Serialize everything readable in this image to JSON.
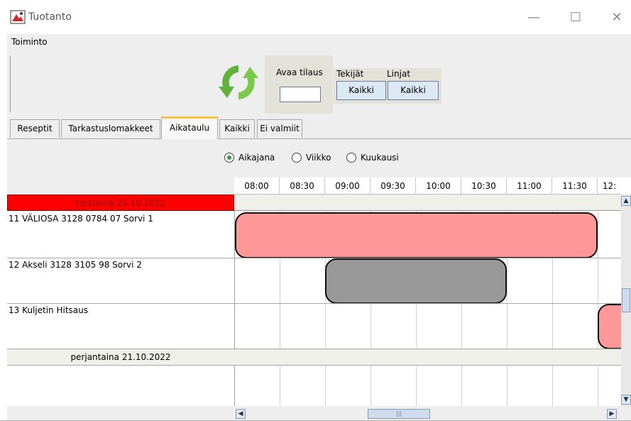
{
  "window": {
    "title": "Tuotanto",
    "minimize": "—",
    "maximize": "☐",
    "close": "✕"
  },
  "menu": {
    "items": [
      "Toiminto"
    ]
  },
  "toolbar": {
    "order_label": "Avaa tilaus",
    "order_value": "",
    "tekijat_label": "Tekijät",
    "linjat_label": "Linjat",
    "tekijat_button": "Kaikki",
    "linjat_button": "Kaikki"
  },
  "tabs": [
    {
      "label": "Reseptit",
      "active": false
    },
    {
      "label": "Tarkastuslomakkeet",
      "active": false
    },
    {
      "label": "Aikataulu",
      "active": true
    },
    {
      "label": "Kaikki",
      "active": false
    },
    {
      "label": "Ei valmiit",
      "active": false
    }
  ],
  "view_options": {
    "selected": "Aikajana",
    "options": [
      "Aikajana",
      "Viikko",
      "Kuukausi"
    ]
  },
  "schedule": {
    "times": [
      "08:00",
      "08:30",
      "09:00",
      "09:30",
      "10:00",
      "10:30",
      "11:00",
      "11:30",
      "12:"
    ],
    "days": [
      {
        "label": "torstaina 20.10.2022",
        "highlighted": true,
        "rows": [
          {
            "label": "11 VÄLIOSA 3128 0784 07 Sorvi 1",
            "task": {
              "start": "08:00",
              "end": "12:00",
              "color": "#ff9999"
            }
          },
          {
            "label": "12 Akseli 3128 3105 98 Sorvi 2",
            "task": {
              "start": "09:00",
              "end": "11:00",
              "color": "#999999"
            }
          },
          {
            "label": "13 Kuljetin Hitsaus",
            "task": {
              "start": "12:00",
              "end": "",
              "color": "#ff9999"
            }
          }
        ]
      },
      {
        "label": "perjantaina 21.10.2022",
        "highlighted": false,
        "rows": []
      }
    ]
  },
  "scrollbars": {
    "up": "▲",
    "down": "▼",
    "left": "◀",
    "right": "▶",
    "grip": "|||"
  }
}
